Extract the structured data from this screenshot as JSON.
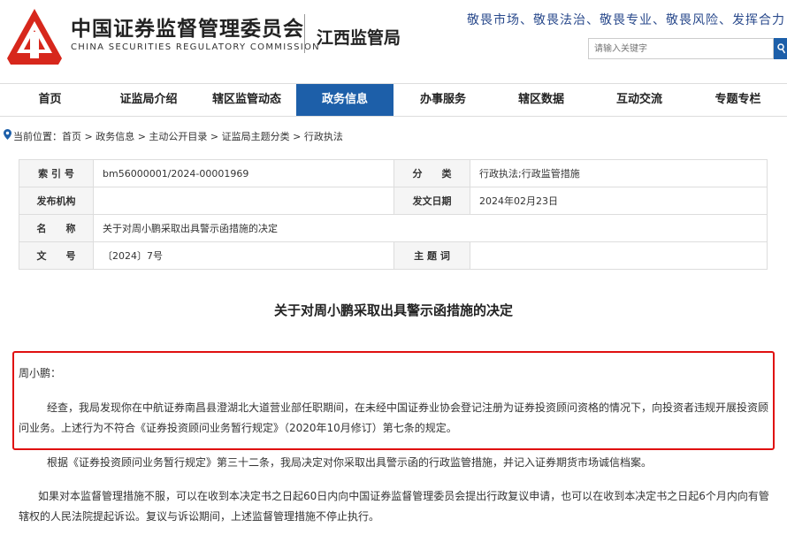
{
  "header": {
    "org_name_cn": "中国证券监督管理委员会",
    "org_name_en": "CHINA SECURITIES REGULATORY COMMISSION",
    "bureau": "江西监管局",
    "slogan": "敬畏市场、敬畏法治、敬畏专业、敬畏风险、发挥合力",
    "search_placeholder": "请输入关键字",
    "logo_color": "#d7271c"
  },
  "nav": {
    "items": [
      {
        "label": "首页"
      },
      {
        "label": "证监局介绍"
      },
      {
        "label": "辖区监管动态"
      },
      {
        "label": "政务信息"
      },
      {
        "label": "办事服务"
      },
      {
        "label": "辖区数据"
      },
      {
        "label": "互动交流"
      },
      {
        "label": "专题专栏"
      }
    ],
    "active_color": "#1d5fa9"
  },
  "breadcrumb": {
    "text": "当前位置：首页 > 政务信息 > 主动公开目录 > 证监局主题分类 > 行政执法"
  },
  "info": {
    "index_label": "索 引 号",
    "index_value": "bm56000001/2024-00001969",
    "category_label": "分　　类",
    "category_value": "行政执法;行政监管措施",
    "issuer_label": "发布机构",
    "issuer_value": "",
    "date_label": "发文日期",
    "date_value": "2024年02月23日",
    "name_label": "名　　称",
    "name_value": "关于对周小鹏采取出具警示函措施的决定",
    "docno_label": "文　　号",
    "docno_value": "〔2024〕7号",
    "subject_label": "主 题 词",
    "subject_value": ""
  },
  "article": {
    "title": "关于对周小鹏采取出具警示函措施的决定",
    "salutation": "周小鹏：",
    "para1": "经查，我局发现你在中航证券南昌县澄湖北大道营业部任职期间，在未经中国证券业协会登记注册为证券投资顾问资格的情况下，向投资者违规开展投资顾问业务。上述行为不符合《证券投资顾问业务暂行规定》（2020年10月修订）第七条的规定。",
    "para2": "根据《证券投资顾问业务暂行规定》第三十二条，我局决定对你采取出具警示函的行政监管措施，并记入证券期货市场诚信档案。",
    "para3": "如果对本监督管理措施不服，可以在收到本决定书之日起60日内向中国证券监督管理委员会提出行政复议申请，也可以在收到本决定书之日起6个月内向有管辖权的人民法院提起诉讼。复议与诉讼期间，上述监督管理措施不停止执行。",
    "highlight_color": "#e01010"
  }
}
